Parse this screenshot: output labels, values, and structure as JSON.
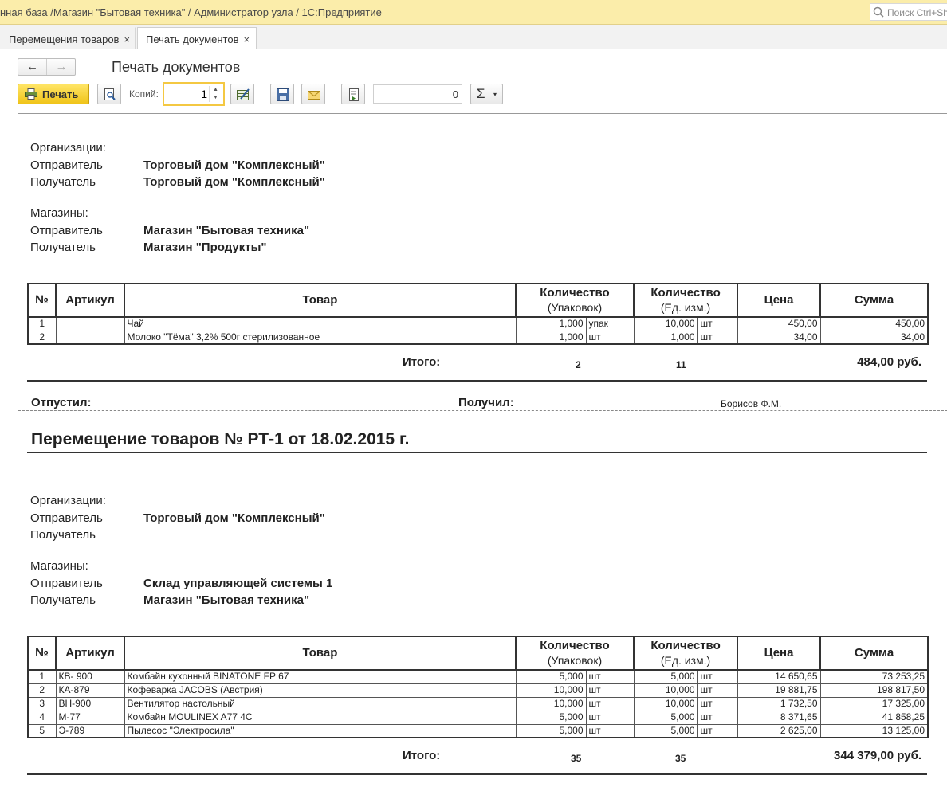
{
  "window": {
    "title": "нная база /Магазин \"Бытовая техника\" / Администратор узла / 1С:Предприятие",
    "search_placeholder": "Поиск Ctrl+Shift+F"
  },
  "tabs": [
    {
      "label": "Перемещения товаров",
      "close": "×"
    },
    {
      "label": "Печать документов",
      "close": "×"
    }
  ],
  "nav": {
    "back": "←",
    "forward": "→"
  },
  "form_title": "Печать документов",
  "toolbar": {
    "print_label": "Печать",
    "copies_label": "Копий:",
    "copies_value": "1",
    "sum_value": "0",
    "sigma": "Σ",
    "sigma_dropdown": "▾"
  },
  "labels": {
    "organizations": "Организации:",
    "shops": "Магазины:",
    "sender": "Отправитель",
    "receiver": "Получатель",
    "total": "Итого:",
    "released": "Отпустил:",
    "received": "Получил:"
  },
  "columns": {
    "num": "№",
    "article": "Артикул",
    "product": "Товар",
    "qty_pack": "Количество",
    "qty_pack_sub": "(Упаковок)",
    "qty_unit": "Количество",
    "qty_unit_sub": "(Ед. изм.)",
    "price": "Цена",
    "sum": "Сумма"
  },
  "doc1": {
    "org_sender": "Торговый дом \"Комплексный\"",
    "org_receiver": "Торговый дом \"Комплексный\"",
    "shop_sender": "Магазин \"Бытовая техника\"",
    "shop_receiver": "Магазин \"Продукты\"",
    "rows": [
      {
        "n": "1",
        "article": "",
        "product": "Чай",
        "qp": "1,000",
        "up": "упак",
        "qu": "10,000",
        "uu": "шт",
        "price": "450,00",
        "sum": "450,00"
      },
      {
        "n": "2",
        "article": "",
        "product": "Молоко \"Тёма\" 3,2% 500г стерилизованное",
        "qp": "1,000",
        "up": "шт",
        "qu": "1,000",
        "uu": "шт",
        "price": "34,00",
        "sum": "34,00"
      }
    ],
    "total_qp": "2",
    "total_qu": "11",
    "total_sum": "484,00 руб.",
    "received_name": "Борисов Ф.М."
  },
  "doc2": {
    "title": "Перемещение товаров № РТ-1 от 18.02.2015 г.",
    "org_sender": "Торговый дом \"Комплексный\"",
    "org_receiver": "",
    "shop_sender": "Склад управляющей системы 1",
    "shop_receiver": "Магазин \"Бытовая техника\"",
    "rows": [
      {
        "n": "1",
        "article": "КВ- 900",
        "product": "Комбайн кухонный BINATONE FP 67",
        "qp": "5,000",
        "up": "шт",
        "qu": "5,000",
        "uu": "шт",
        "price": "14 650,65",
        "sum": "73 253,25"
      },
      {
        "n": "2",
        "article": "КА-879",
        "product": "Кофеварка JACOBS (Австрия)",
        "qp": "10,000",
        "up": "шт",
        "qu": "10,000",
        "uu": "шт",
        "price": "19 881,75",
        "sum": "198 817,50"
      },
      {
        "n": "3",
        "article": "ВН-900",
        "product": "Вентилятор настольный",
        "qp": "10,000",
        "up": "шт",
        "qu": "10,000",
        "uu": "шт",
        "price": "1 732,50",
        "sum": "17 325,00"
      },
      {
        "n": "4",
        "article": "М-77",
        "product": "Комбайн MOULINEX  A77 4C",
        "qp": "5,000",
        "up": "шт",
        "qu": "5,000",
        "uu": "шт",
        "price": "8 371,65",
        "sum": "41 858,25"
      },
      {
        "n": "5",
        "article": "Э-789",
        "product": "Пылесос \"Электросила\"",
        "qp": "5,000",
        "up": "шт",
        "qu": "5,000",
        "uu": "шт",
        "price": "2 625,00",
        "sum": "13 125,00"
      }
    ],
    "total_qp": "35",
    "total_qu": "35",
    "total_sum": "344 379,00 руб."
  }
}
